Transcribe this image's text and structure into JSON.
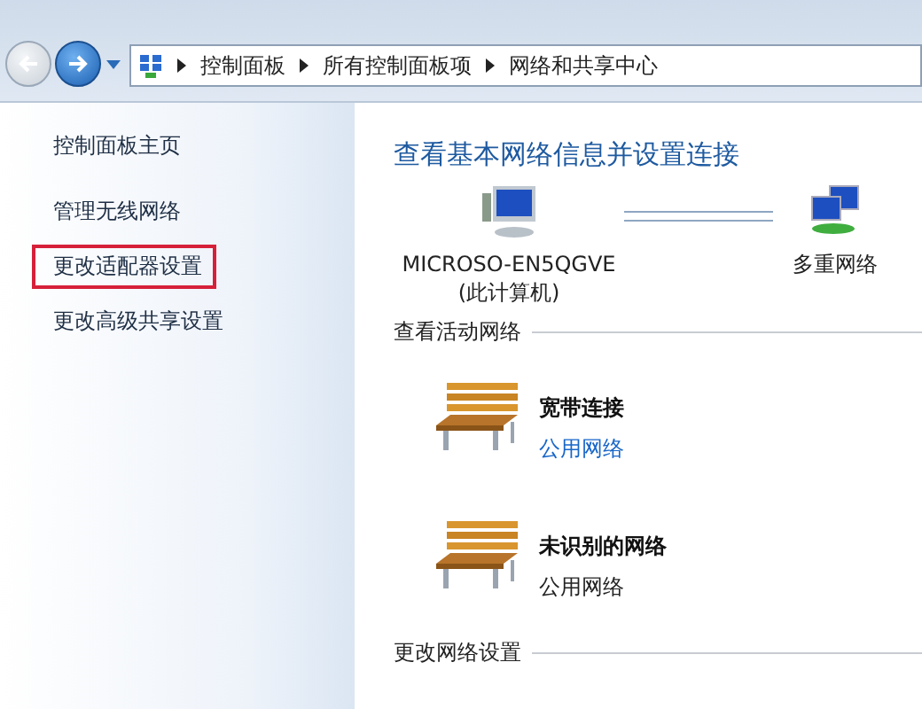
{
  "breadcrumb": [
    "控制面板",
    "所有控制面板项",
    "网络和共享中心"
  ],
  "sidebar": {
    "items": [
      {
        "label": "控制面板主页",
        "highlighted": false
      },
      {
        "label": "管理无线网络",
        "highlighted": false
      },
      {
        "label": "更改适配器设置",
        "highlighted": true
      },
      {
        "label": "更改高级共享设置",
        "highlighted": false
      }
    ]
  },
  "main": {
    "title": "查看基本网络信息并设置连接",
    "map": [
      {
        "kind": "computer",
        "name": "MICROSO-EN5QGVE",
        "sub": "(此计算机)"
      },
      {
        "kind": "network",
        "name": "多重网络"
      }
    ],
    "active_heading": "查看活动网络",
    "networks": [
      {
        "name": "宽带连接",
        "type": "公用网络",
        "link": true
      },
      {
        "name": "未识别的网络",
        "type": "公用网络",
        "link": false
      }
    ],
    "settings_heading": "更改网络设置"
  }
}
